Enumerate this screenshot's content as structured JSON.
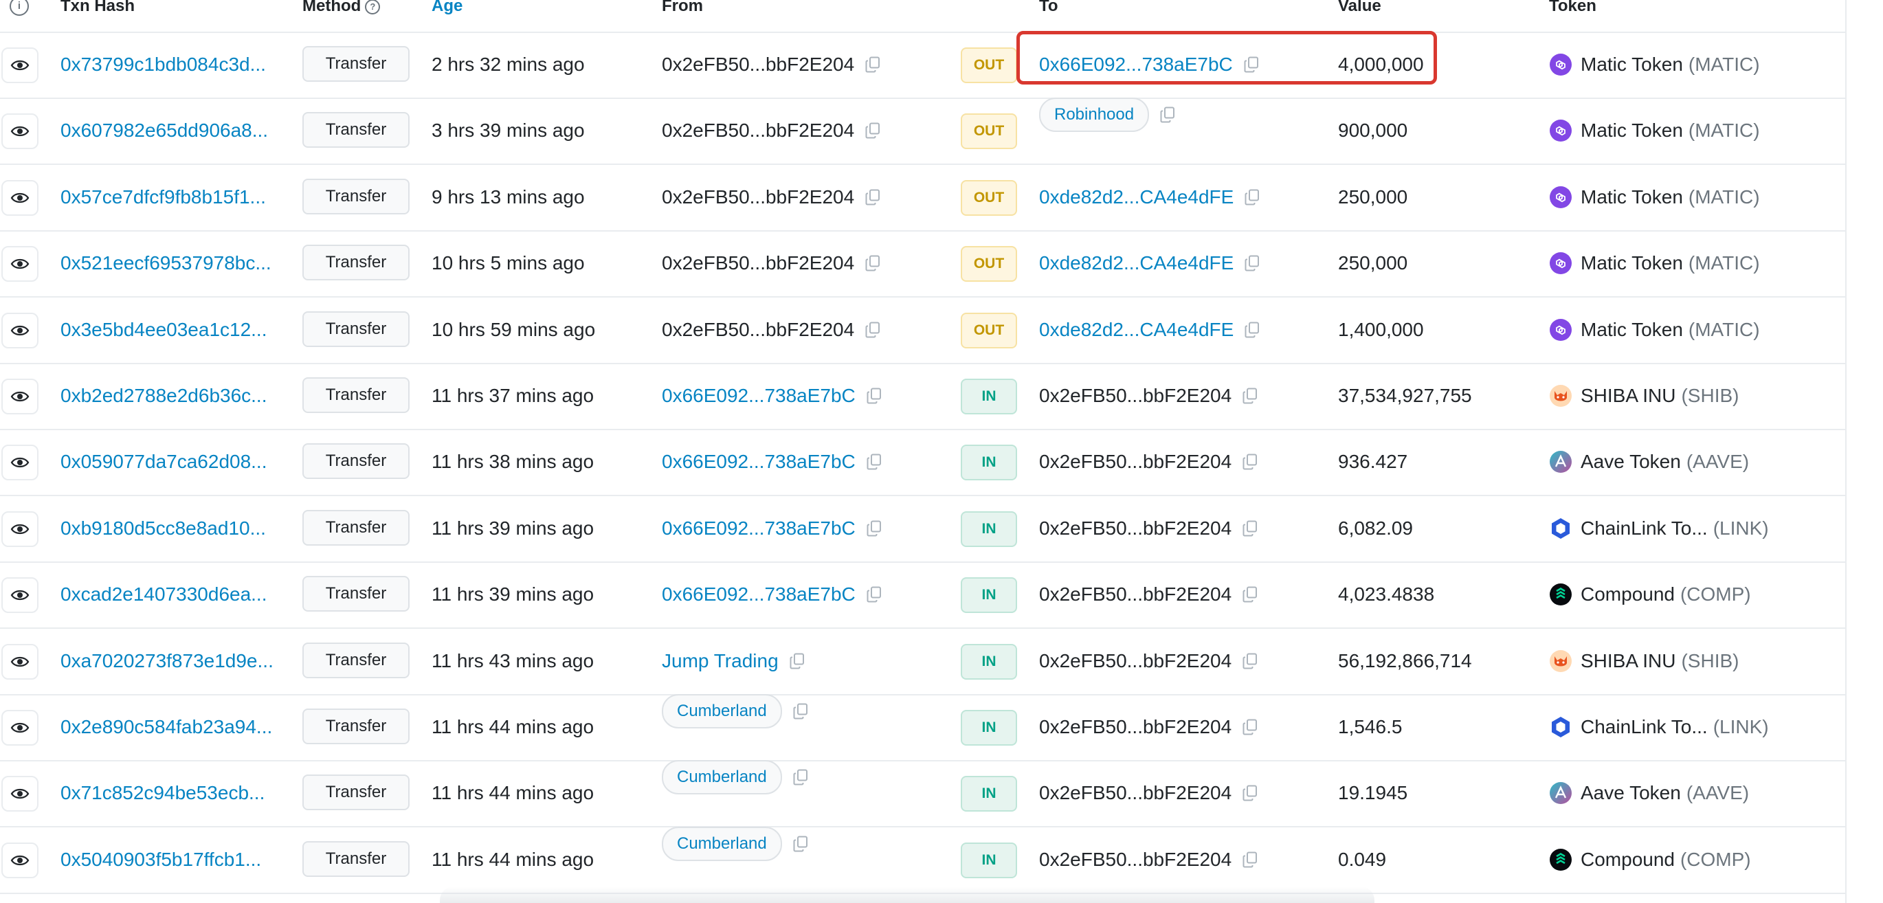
{
  "header": {
    "info_icon": "info-icon",
    "txn_hash": "Txn Hash",
    "method": "Method",
    "method_help": "?",
    "age": "Age",
    "from": "From",
    "to": "To",
    "value": "Value",
    "token": "Token"
  },
  "colors": {
    "link": "#0784c3",
    "out_text": "#c29600",
    "in_text": "#00a186",
    "highlight": "#d9382f"
  },
  "rows": [
    {
      "hash": "0x73799c1bdb084c3d...",
      "method": "Transfer",
      "age": "2 hrs 32 mins ago",
      "from": "0x2eFB50...bbF2E204",
      "from_type": "plain",
      "dir": "OUT",
      "to": "0x66E092...738aE7bC",
      "to_type": "link",
      "value": "4,000,000",
      "token_name": "Matic Token",
      "token_symbol": "(MATIC)",
      "token_icon": "matic-icon"
    },
    {
      "hash": "0x607982e65dd906a8...",
      "method": "Transfer",
      "age": "3 hrs 39 mins ago",
      "from": "0x2eFB50...bbF2E204",
      "from_type": "plain",
      "dir": "OUT",
      "to": "Robinhood",
      "to_type": "pill",
      "value": "900,000",
      "token_name": "Matic Token",
      "token_symbol": "(MATIC)",
      "token_icon": "matic-icon"
    },
    {
      "hash": "0x57ce7dfcf9fb8b15f1...",
      "method": "Transfer",
      "age": "9 hrs 13 mins ago",
      "from": "0x2eFB50...bbF2E204",
      "from_type": "plain",
      "dir": "OUT",
      "to": "0xde82d2...CA4e4dFE",
      "to_type": "link",
      "value": "250,000",
      "token_name": "Matic Token",
      "token_symbol": "(MATIC)",
      "token_icon": "matic-icon"
    },
    {
      "hash": "0x521eecf69537978bc...",
      "method": "Transfer",
      "age": "10 hrs 5 mins ago",
      "from": "0x2eFB50...bbF2E204",
      "from_type": "plain",
      "dir": "OUT",
      "to": "0xde82d2...CA4e4dFE",
      "to_type": "link",
      "value": "250,000",
      "token_name": "Matic Token",
      "token_symbol": "(MATIC)",
      "token_icon": "matic-icon"
    },
    {
      "hash": "0x3e5bd4ee03ea1c12...",
      "method": "Transfer",
      "age": "10 hrs 59 mins ago",
      "from": "0x2eFB50...bbF2E204",
      "from_type": "plain",
      "dir": "OUT",
      "to": "0xde82d2...CA4e4dFE",
      "to_type": "link",
      "value": "1,400,000",
      "token_name": "Matic Token",
      "token_symbol": "(MATIC)",
      "token_icon": "matic-icon"
    },
    {
      "hash": "0xb2ed2788e2d6b36c...",
      "method": "Transfer",
      "age": "11 hrs 37 mins ago",
      "from": "0x66E092...738aE7bC",
      "from_type": "link",
      "dir": "IN",
      "to": "0x2eFB50...bbF2E204",
      "to_type": "plain",
      "value": "37,534,927,755",
      "token_name": "SHIBA INU",
      "token_symbol": "(SHIB)",
      "token_icon": "shib-icon"
    },
    {
      "hash": "0x059077da7ca62d08...",
      "method": "Transfer",
      "age": "11 hrs 38 mins ago",
      "from": "0x66E092...738aE7bC",
      "from_type": "link",
      "dir": "IN",
      "to": "0x2eFB50...bbF2E204",
      "to_type": "plain",
      "value": "936.427",
      "token_name": "Aave Token",
      "token_symbol": "(AAVE)",
      "token_icon": "aave-icon"
    },
    {
      "hash": "0xb9180d5cc8e8ad10...",
      "method": "Transfer",
      "age": "11 hrs 39 mins ago",
      "from": "0x66E092...738aE7bC",
      "from_type": "link",
      "dir": "IN",
      "to": "0x2eFB50...bbF2E204",
      "to_type": "plain",
      "value": "6,082.09",
      "token_name": "ChainLink To...",
      "token_symbol": "(LINK)",
      "token_icon": "chainlink-icon"
    },
    {
      "hash": "0xcad2e1407330d6ea...",
      "method": "Transfer",
      "age": "11 hrs 39 mins ago",
      "from": "0x66E092...738aE7bC",
      "from_type": "link",
      "dir": "IN",
      "to": "0x2eFB50...bbF2E204",
      "to_type": "plain",
      "value": "4,023.4838",
      "token_name": "Compound",
      "token_symbol": "(COMP)",
      "token_icon": "compound-icon"
    },
    {
      "hash": "0xa7020273f873e1d9e...",
      "method": "Transfer",
      "age": "11 hrs 43 mins ago",
      "from": "Jump Trading",
      "from_type": "link",
      "dir": "IN",
      "to": "0x2eFB50...bbF2E204",
      "to_type": "plain",
      "value": "56,192,866,714",
      "token_name": "SHIBA INU",
      "token_symbol": "(SHIB)",
      "token_icon": "shib-icon"
    },
    {
      "hash": "0x2e890c584fab23a94...",
      "method": "Transfer",
      "age": "11 hrs 44 mins ago",
      "from": "Cumberland",
      "from_type": "pill",
      "dir": "IN",
      "to": "0x2eFB50...bbF2E204",
      "to_type": "plain",
      "value": "1,546.5",
      "token_name": "ChainLink To...",
      "token_symbol": "(LINK)",
      "token_icon": "chainlink-icon"
    },
    {
      "hash": "0x71c852c94be53ecb...",
      "method": "Transfer",
      "age": "11 hrs 44 mins ago",
      "from": "Cumberland",
      "from_type": "pill",
      "dir": "IN",
      "to": "0x2eFB50...bbF2E204",
      "to_type": "plain",
      "value": "19.1945",
      "token_name": "Aave Token",
      "token_symbol": "(AAVE)",
      "token_icon": "aave-icon"
    },
    {
      "hash": "0x5040903f5b17ffcb1...",
      "method": "Transfer",
      "age": "11 hrs 44 mins ago",
      "from": "Cumberland",
      "from_type": "pill",
      "dir": "IN",
      "to": "0x2eFB50...bbF2E204",
      "to_type": "plain",
      "value": "0.049",
      "token_name": "Compound",
      "token_symbol": "(COMP)",
      "token_icon": "compound-icon"
    }
  ]
}
